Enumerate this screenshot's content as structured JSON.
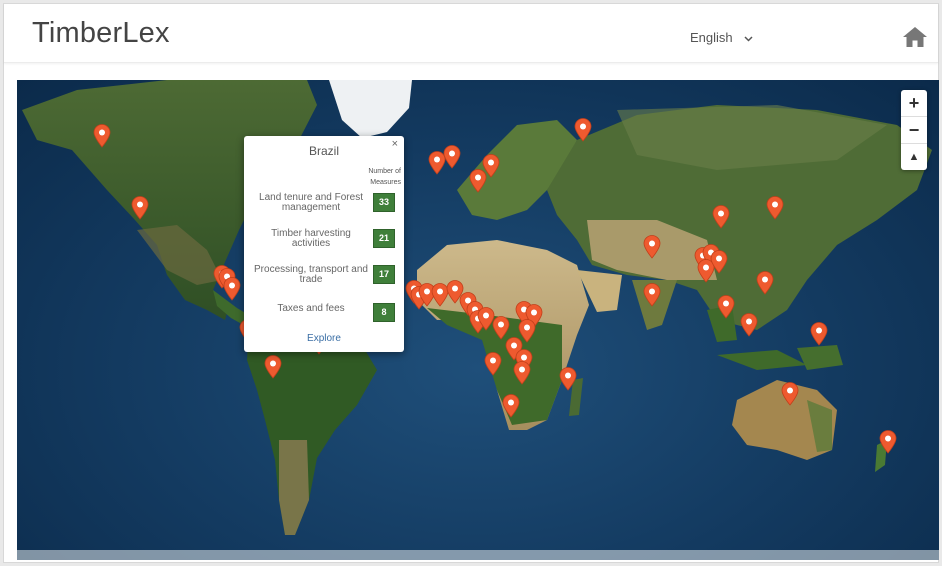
{
  "header": {
    "brand": "TimberLex",
    "language": "English"
  },
  "colors": {
    "pin": "#ee5a2f",
    "badge": "#3f7f3a",
    "link": "#3a6ea5"
  },
  "icons": {
    "home": "home-icon",
    "language_toggle": "chevron-down-icon",
    "close": "close-icon",
    "marker": "map-marker-icon"
  },
  "zoom": {
    "in": "+",
    "out": "−",
    "north": "▲"
  },
  "popup": {
    "country": "Brazil",
    "close": "×",
    "column_header": "Number of Measures",
    "rows": [
      {
        "label": "Land tenure and Forest management",
        "value": "33"
      },
      {
        "label": "Timber harvesting activities",
        "value": "21"
      },
      {
        "label": "Processing, transport and trade",
        "value": "17"
      },
      {
        "label": "Taxes and fees",
        "value": "8"
      }
    ],
    "explore": "Explore"
  },
  "markers": [
    {
      "lat": 61,
      "lon": -135
    },
    {
      "lat": 37,
      "lon": -120
    },
    {
      "lat": 14,
      "lon": -88
    },
    {
      "lat": 13,
      "lon": -86
    },
    {
      "lat": 10,
      "lon": -84
    },
    {
      "lat": -4,
      "lon": -78
    },
    {
      "lat": -16,
      "lon": -68
    },
    {
      "lat": -8,
      "lon": -50
    },
    {
      "lat": 52,
      "lon": -4
    },
    {
      "lat": 54,
      "lon": 2
    },
    {
      "lat": 46,
      "lon": 12
    },
    {
      "lat": 51,
      "lon": 17
    },
    {
      "lat": 63,
      "lon": 53
    },
    {
      "lat": 24,
      "lon": 80
    },
    {
      "lat": 8,
      "lon": 80
    },
    {
      "lat": 34,
      "lon": 107
    },
    {
      "lat": 37,
      "lon": 128
    },
    {
      "lat": 20,
      "lon": 100
    },
    {
      "lat": 21,
      "lon": 103
    },
    {
      "lat": 16,
      "lon": 101
    },
    {
      "lat": 19,
      "lon": 106
    },
    {
      "lat": 4,
      "lon": 109
    },
    {
      "lat": 12,
      "lon": 124
    },
    {
      "lat": -2,
      "lon": 118
    },
    {
      "lat": -5,
      "lon": 145
    },
    {
      "lat": -25,
      "lon": 134
    },
    {
      "lat": -41,
      "lon": 172
    },
    {
      "lat": 9,
      "lon": -13
    },
    {
      "lat": 7,
      "lon": -11
    },
    {
      "lat": 8,
      "lon": -8
    },
    {
      "lat": 8,
      "lon": -3
    },
    {
      "lat": 9,
      "lon": 3
    },
    {
      "lat": 5,
      "lon": 8
    },
    {
      "lat": 2,
      "lon": 11
    },
    {
      "lat": -1,
      "lon": 12
    },
    {
      "lat": 0,
      "lon": 15
    },
    {
      "lat": -3,
      "lon": 21
    },
    {
      "lat": 2,
      "lon": 30
    },
    {
      "lat": 1,
      "lon": 34
    },
    {
      "lat": -4,
      "lon": 31
    },
    {
      "lat": -10,
      "lon": 26
    },
    {
      "lat": -14,
      "lon": 30
    },
    {
      "lat": -18,
      "lon": 29
    },
    {
      "lat": -20,
      "lon": 47
    },
    {
      "lat": -29,
      "lon": 25
    },
    {
      "lat": -15,
      "lon": 18
    }
  ]
}
